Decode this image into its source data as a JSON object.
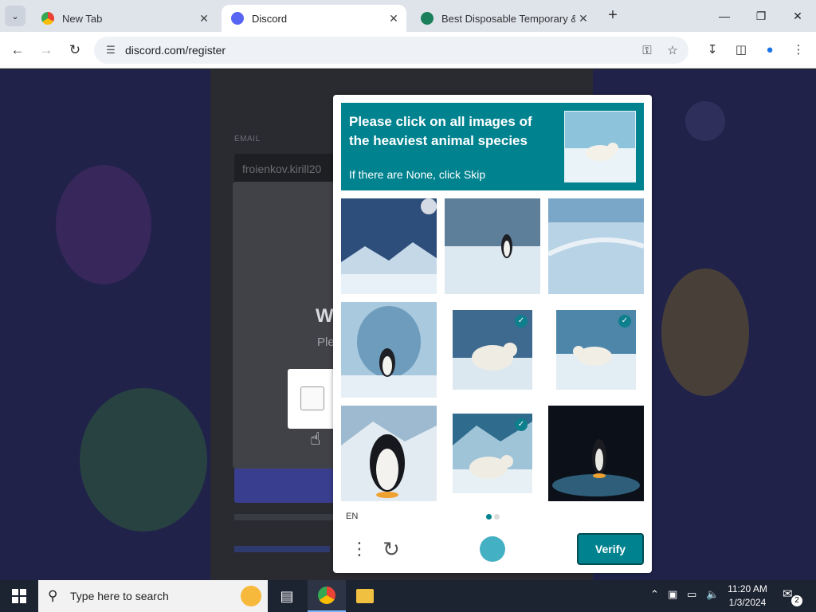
{
  "browser": {
    "tabs": [
      {
        "title": "New Tab",
        "icon": "chrome-icon",
        "active": false
      },
      {
        "title": "Discord",
        "icon": "discord-icon",
        "active": true
      },
      {
        "title": "Best Disposable Temporary & F",
        "icon": "tempmail-icon",
        "active": false
      }
    ],
    "url": "discord.com/register"
  },
  "discord": {
    "email_label": "EMAIL",
    "email_value": "froienkov.kirill20",
    "modal_title": "W",
    "modal_sub": "Ple"
  },
  "captcha": {
    "prompt_title": "Please click on all images of the heaviest animal species",
    "prompt_sub": "If there are None, click Skip",
    "tiles": [
      {
        "subject": "landscape",
        "selected": false
      },
      {
        "subject": "penguin",
        "selected": false
      },
      {
        "subject": "landscape",
        "selected": false
      },
      {
        "subject": "penguin",
        "selected": false
      },
      {
        "subject": "polar-bear",
        "selected": true
      },
      {
        "subject": "polar-bear",
        "selected": true
      },
      {
        "subject": "penguin",
        "selected": false
      },
      {
        "subject": "polar-bear",
        "selected": true
      },
      {
        "subject": "penguin",
        "selected": false
      }
    ],
    "language": "EN",
    "verify_label": "Verify",
    "colors": {
      "accent": "#00838f"
    }
  },
  "taskbar": {
    "search_placeholder": "Type here to search",
    "time": "11:20 AM",
    "date": "1/3/2024",
    "notification_count": "2"
  }
}
